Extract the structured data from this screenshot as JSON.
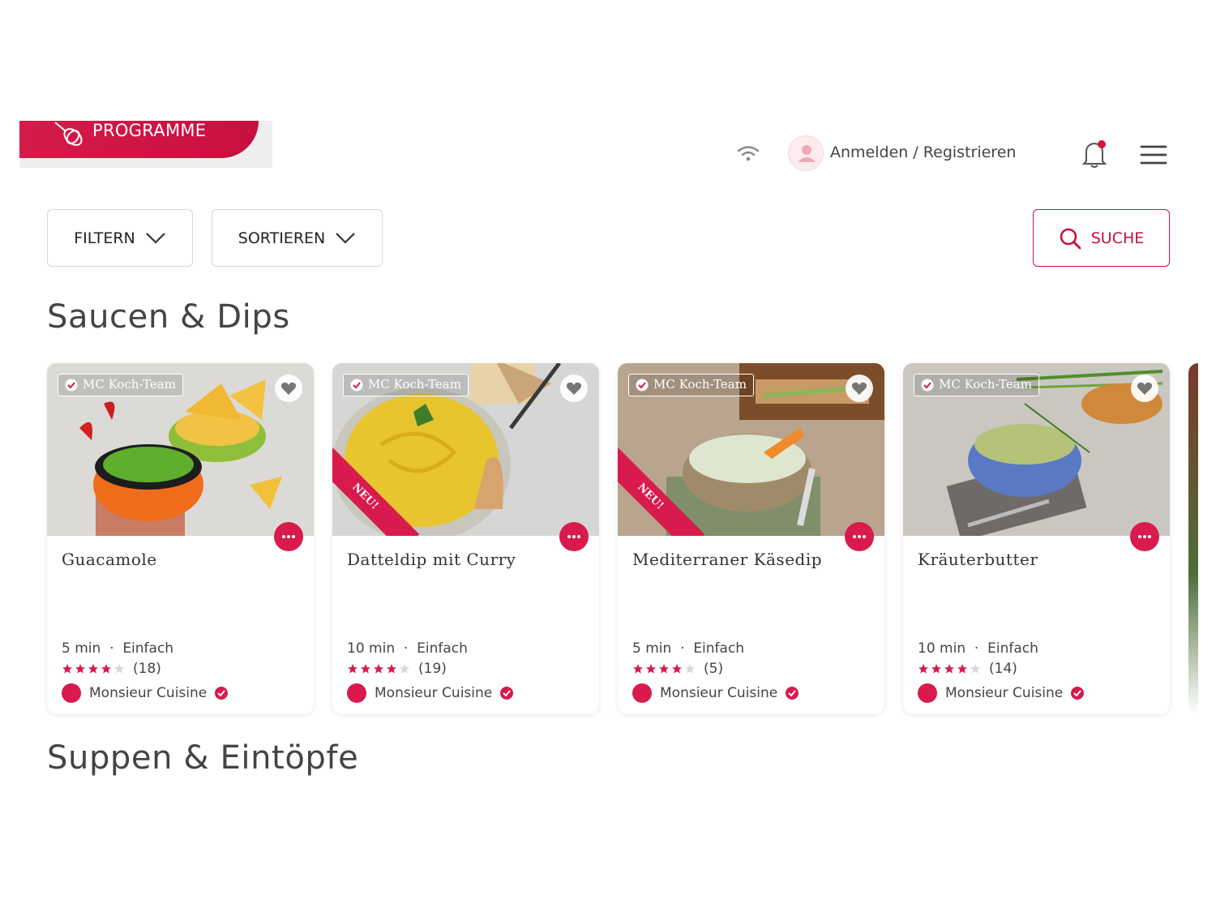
{
  "header": {
    "programme_label": "PROGRAMME",
    "auth_label": "Anmelden / Registrieren",
    "accent_color": "#d0103f"
  },
  "toolbar": {
    "filter_label": "FILTERN",
    "sort_label": "SORTIEREN",
    "search_label": "SUCHE"
  },
  "sections": [
    {
      "title": "Saucen & Dips"
    },
    {
      "title": "Suppen & Eintöpfe"
    }
  ],
  "cards": [
    {
      "title": "Guacamole",
      "team": "MC Koch-Team",
      "time": "5 min",
      "difficulty": "Einfach",
      "rating": 4,
      "rating_count": "(18)",
      "author": "Monsieur Cuisine",
      "new": false,
      "new_label": ""
    },
    {
      "title": "Datteldip mit Curry",
      "team": "MC Koch-Team",
      "time": "10 min",
      "difficulty": "Einfach",
      "rating": 4,
      "rating_count": "(19)",
      "author": "Monsieur Cuisine",
      "new": true,
      "new_label": "NEU!"
    },
    {
      "title": "Mediterraner Käsedip",
      "team": "MC Koch-Team",
      "time": "5 min",
      "difficulty": "Einfach",
      "rating": 4,
      "rating_count": "(5)",
      "author": "Monsieur Cuisine",
      "new": true,
      "new_label": "NEU!"
    },
    {
      "title": "Kräuterbutter",
      "team": "MC Koch-Team",
      "time": "10 min",
      "difficulty": "Einfach",
      "rating": 4,
      "rating_count": "(14)",
      "author": "Monsieur Cuisine",
      "new": false,
      "new_label": ""
    }
  ]
}
